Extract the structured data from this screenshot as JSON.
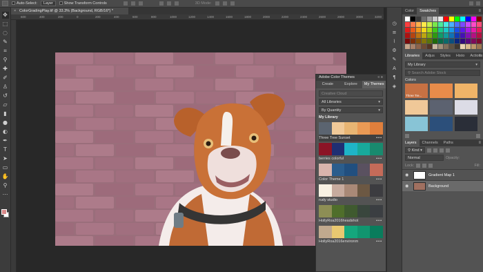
{
  "options_bar": {
    "auto_select_label": "Auto-Select:",
    "layer_select": "Layer",
    "transform_label": "Show Transform Controls",
    "mode_label": "3D Mode:"
  },
  "document": {
    "tab_title": "ColorGradingPlay.tif @ 33.3% (Background, RGB/16*) *",
    "ruler_ticks": [
      "600",
      "400",
      "200",
      "0",
      "200",
      "400",
      "600",
      "800",
      "1000",
      "1200",
      "1400",
      "1600",
      "1800",
      "2000",
      "2200",
      "2400",
      "2600",
      "2800",
      "3000",
      "3200"
    ]
  },
  "color_themes": {
    "title": "Adobe Color Themes",
    "tabs": [
      "Create",
      "Explore",
      "My Themes"
    ],
    "active_tab": "My Themes",
    "source": "Creative Cloud",
    "library": "All Libraries",
    "sort": "By Quantity",
    "section": "My Library",
    "themes": [
      {
        "name": "Three Tree Sunset",
        "colors": [
          "#5b6470",
          "#f0c998",
          "#e8b573",
          "#e99a55",
          "#e07f3c"
        ]
      },
      {
        "name": "berries colorful",
        "colors": [
          "#8b1426",
          "#1f2f73",
          "#1fb4c7",
          "#18a99b",
          "#198a6e"
        ]
      },
      {
        "name": "Color Theme 1",
        "colors": [
          "#d8b4ac",
          "#2b5d8c",
          "#214f7f",
          "#5a5160",
          "#c56b59"
        ]
      },
      {
        "name": "rudy studio",
        "colors": [
          "#f8f1e3",
          "#c7ab9e",
          "#a98977",
          "#6c5843",
          "#3c3c40"
        ]
      },
      {
        "name": "HollyRoa2016headshot",
        "colors": [
          "#8d8e55",
          "#4f6e2b",
          "#3f5a2f",
          "#39463d",
          "#3b3e42"
        ]
      },
      {
        "name": "HollyRoa2016environm",
        "colors": [
          "#c0a98e",
          "#e8c871",
          "#15a77d",
          "#11956f",
          "#097c5c"
        ]
      }
    ]
  },
  "right_panel": {
    "tabs_top": [
      "Color",
      "Swatches"
    ],
    "active_top": "Swatches",
    "swatches": [
      "#ffffff",
      "#000000",
      "#3a3a3a",
      "#6e6e6e",
      "#9b9b9b",
      "#c8c8c8",
      "#e8e8e8",
      "#ff0000",
      "#ffff00",
      "#00ff00",
      "#00ffff",
      "#0000ff",
      "#ff00ff",
      "#7f0000",
      "#ff3d3d",
      "#ff7b4a",
      "#ffb04a",
      "#ffe94a",
      "#c9f04a",
      "#7ae84a",
      "#4ae89a",
      "#4ae8e0",
      "#4ab0ff",
      "#4a72ff",
      "#7a4aff",
      "#c94aff",
      "#ff4ac9",
      "#ff4a7b",
      "#e21a1a",
      "#e85b1a",
      "#f2981a",
      "#f2d51a",
      "#a9d81a",
      "#3fc81a",
      "#1ac889",
      "#1ac8c8",
      "#1a98e8",
      "#1a4de8",
      "#5b1ae8",
      "#a91ae8",
      "#e81aa9",
      "#e81a5b",
      "#b01010",
      "#b54410",
      "#bd7310",
      "#bda610",
      "#82a810",
      "#2e9a10",
      "#109a69",
      "#109a9a",
      "#1072b5",
      "#1038b5",
      "#4410b5",
      "#8210b5",
      "#b51082",
      "#b51044",
      "#7a0a0a",
      "#7d2f0a",
      "#82500a",
      "#82730a",
      "#5a740a",
      "#206a0a",
      "#0a6a48",
      "#0a6a6a",
      "#0a4f7d",
      "#0a267d",
      "#2f0a7d",
      "#5a0a7d",
      "#7d0a5a",
      "#7d0a2f",
      "#c8a58a",
      "#a98168",
      "#8c634a",
      "#6e4a34",
      "#553624",
      "#c9b8a0",
      "#a2917a",
      "#7f6f5b",
      "#5e5242",
      "#403830",
      "#e8d2b0",
      "#d8b88c",
      "#bd966a",
      "#9c7550"
    ],
    "tabs_lib": [
      "Libraries",
      "Adjus",
      "Styles",
      "Histo",
      "Actions"
    ],
    "active_lib": "Libraries",
    "library_select": "My Library",
    "search_placeholder": "Search Adobe Stock",
    "colors_label": "Colors",
    "library_colors": [
      {
        "color": "#c77143",
        "label": "Three Tre..."
      },
      {
        "color": "#e88c4a",
        "label": ""
      },
      {
        "color": "#f0b468",
        "label": ""
      },
      {
        "color": "#f0c898",
        "label": ""
      },
      {
        "color": "#5c6270",
        "label": ""
      },
      {
        "color": "#dcdce6",
        "label": ""
      },
      {
        "color": "#88c4d6",
        "label": ""
      },
      {
        "color": "#2c4f7a",
        "label": ""
      },
      {
        "color": "#2a2e38",
        "label": ""
      }
    ],
    "tabs_layers": [
      "Layers",
      "Channels",
      "Paths"
    ],
    "active_layers": "Layers",
    "kind_label": "Kind",
    "blend_mode": "Normal",
    "opacity_label": "Opacity:",
    "lock_label": "Lock:",
    "fill_label": "Fill:",
    "layers": [
      {
        "name": "Gradient Map 1",
        "selected": false,
        "thumb": "#ffffff"
      },
      {
        "name": "Background",
        "selected": true,
        "thumb": "#a07060"
      }
    ]
  }
}
